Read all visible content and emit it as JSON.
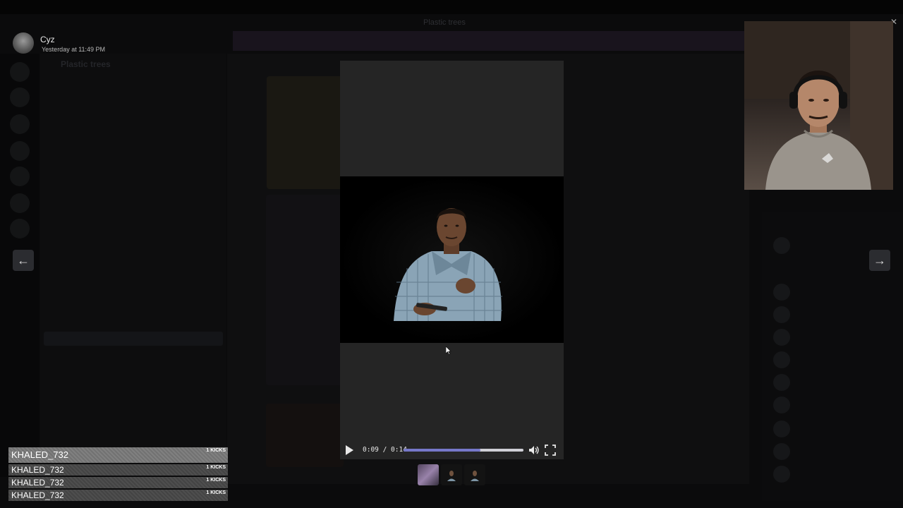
{
  "window": {
    "title": "Plastic trees"
  },
  "banner": {
    "text": "…"
  },
  "server": {
    "name": "Plastic trees"
  },
  "viewer": {
    "author": "Cyz",
    "timestamp": "Yesterday at 11:49 PM"
  },
  "video": {
    "current_time": "0:09",
    "duration": "0:14",
    "time_display": "0:09 / 0:14",
    "progress": 0.64
  },
  "navigation": {
    "prev_icon": "arrow-left-icon",
    "next_icon": "arrow-right-icon"
  },
  "thumbnails": [
    "thumb-1",
    "thumb-2",
    "thumb-3"
  ],
  "kicks": [
    {
      "name": "KHALED_732",
      "count": "1 KICKS"
    },
    {
      "name": "KHALED_732",
      "count": "1 KICKS"
    },
    {
      "name": "KHALED_732",
      "count": "1 KICKS"
    },
    {
      "name": "KHALED_732",
      "count": "1 KICKS"
    }
  ],
  "colors": {
    "progress_fill": "#7678c9",
    "player_bg": "#252525",
    "overlay_bg": "#0b0b0c"
  }
}
